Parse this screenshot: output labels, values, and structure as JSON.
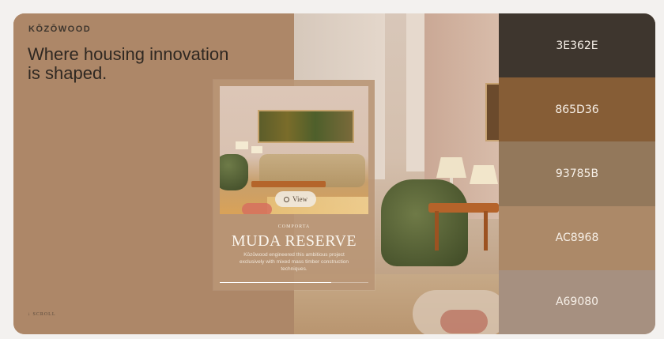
{
  "brand": {
    "logo": "KŌZŌWOOD"
  },
  "hero": {
    "headline": "Where housing innovation is shaped."
  },
  "scroll": {
    "label": "↓ SCROLL"
  },
  "card": {
    "eyebrow": "COMPORTA",
    "title": "MUDA RESERVE",
    "description": "Kōzōwood engineered this ambitious project exclusively with mixed mass timber construction techniques.",
    "view_label": "View",
    "progress": 0.75
  },
  "palette": [
    {
      "hex": "3E362E",
      "color": "#3E362E"
    },
    {
      "hex": "865D36",
      "color": "#865D36"
    },
    {
      "hex": "93785B",
      "color": "#93785B"
    },
    {
      "hex": "AC8968",
      "color": "#AC8968"
    },
    {
      "hex": "A69080",
      "color": "#A69080"
    }
  ]
}
